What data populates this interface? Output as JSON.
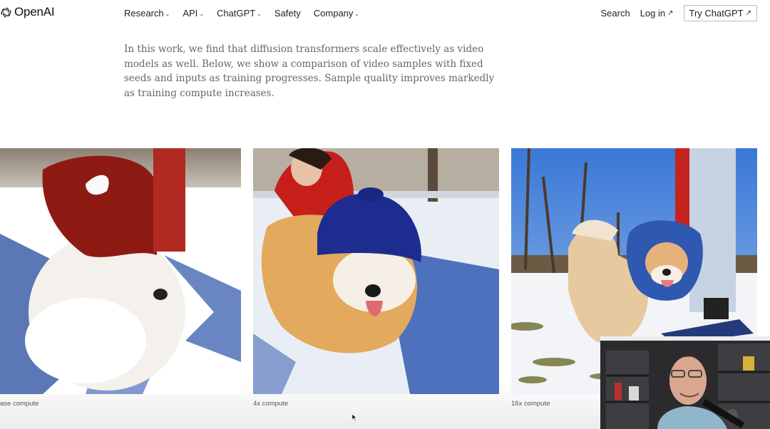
{
  "brand": {
    "name": "OpenAI",
    "logo_icon": "openai-logo-icon"
  },
  "nav": {
    "items": [
      {
        "label": "Research",
        "dropdown": true
      },
      {
        "label": "API",
        "dropdown": true
      },
      {
        "label": "ChatGPT",
        "dropdown": true
      },
      {
        "label": "Safety",
        "dropdown": false
      },
      {
        "label": "Company",
        "dropdown": true
      }
    ],
    "search_label": "Search",
    "login_label": "Log in",
    "try_label": "Try ChatGPT",
    "external_arrow": "↗",
    "chevron": "⌄"
  },
  "main": {
    "intro_text": "In this work, we find that diffusion transformers scale effectively as video models as well. Below, we show a comparison of video samples with fixed seeds and inputs as training progresses. Sample quality improves markedly as training compute increases."
  },
  "videos": [
    {
      "caption": "ase compute"
    },
    {
      "caption": "4x compute"
    },
    {
      "caption": "16x compute"
    }
  ]
}
